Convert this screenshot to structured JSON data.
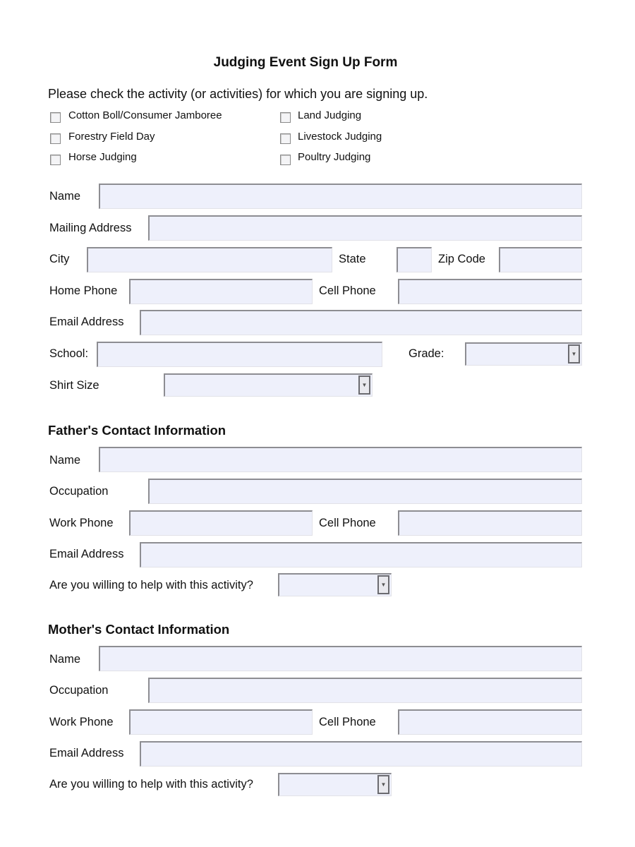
{
  "title": "Judging Event Sign Up Form",
  "intro": "Please check the activity (or activities) for which you are signing up.",
  "activities": [
    {
      "label": "Cotton Boll/Consumer Jamboree",
      "checked": false
    },
    {
      "label": "Forestry Field Day",
      "checked": false
    },
    {
      "label": "Horse Judging",
      "checked": false
    },
    {
      "label": "Land Judging",
      "checked": false
    },
    {
      "label": "Livestock Judging",
      "checked": false
    },
    {
      "label": "Poultry Judging",
      "checked": false
    }
  ],
  "student": {
    "name": {
      "label": "Name",
      "value": ""
    },
    "mailing_address": {
      "label": "Mailing Address",
      "value": ""
    },
    "city": {
      "label": "City",
      "value": ""
    },
    "state": {
      "label": "State",
      "value": ""
    },
    "zip": {
      "label": "Zip Code",
      "value": ""
    },
    "home_phone": {
      "label": "Home Phone",
      "value": ""
    },
    "cell_phone": {
      "label": "Cell Phone",
      "value": ""
    },
    "email": {
      "label": "Email Address",
      "value": ""
    },
    "school": {
      "label": "School:",
      "value": ""
    },
    "grade": {
      "label": "Grade:",
      "value": ""
    },
    "shirt_size": {
      "label": "Shirt Size",
      "value": ""
    }
  },
  "father": {
    "heading": "Father's Contact Information",
    "name": {
      "label": "Name",
      "value": ""
    },
    "occupation": {
      "label": "Occupation",
      "value": ""
    },
    "work_phone": {
      "label": "Work Phone",
      "value": ""
    },
    "cell_phone": {
      "label": "Cell Phone",
      "value": ""
    },
    "email": {
      "label": "Email Address",
      "value": ""
    },
    "help": {
      "label": "Are you willing to help with this activity?",
      "value": ""
    }
  },
  "mother": {
    "heading": "Mother's Contact Information",
    "name": {
      "label": "Name",
      "value": ""
    },
    "occupation": {
      "label": "Occupation",
      "value": ""
    },
    "work_phone": {
      "label": "Work Phone",
      "value": ""
    },
    "cell_phone": {
      "label": "Cell Phone",
      "value": ""
    },
    "email": {
      "label": "Email Address",
      "value": ""
    },
    "help": {
      "label": "Are you willing to help with this activity?",
      "value": ""
    }
  },
  "icons": {
    "dropdown": "chevron-down-icon",
    "dropdown_glyph": "▼"
  }
}
